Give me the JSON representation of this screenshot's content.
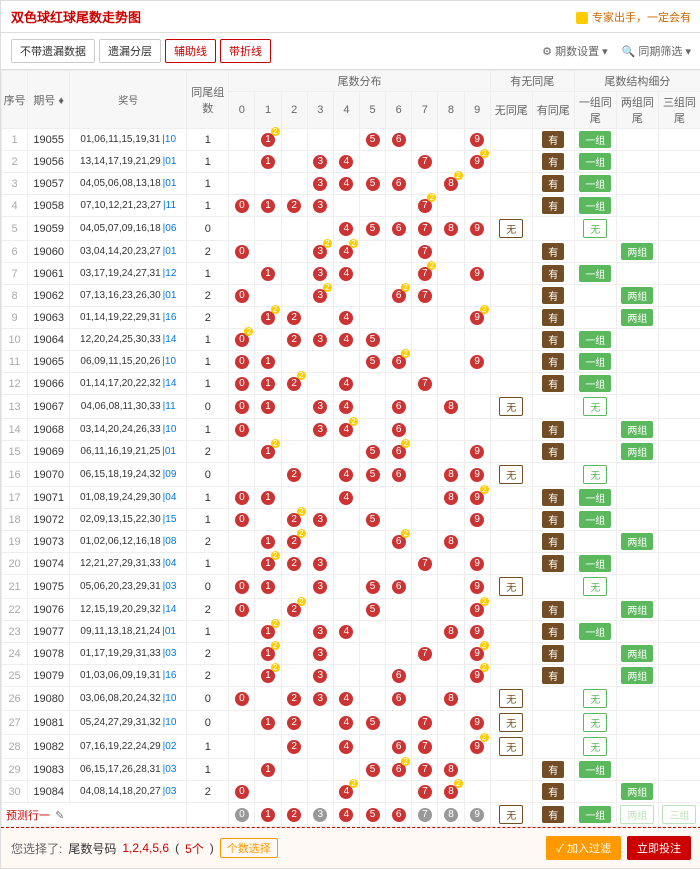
{
  "title": "双色球红球尾数走势图",
  "tip": "专家出手，一定会有",
  "ctrl": {
    "nodist": "不带遗漏数据",
    "distlayer": "遗漏分层",
    "aux": "辅助线",
    "fold": "带折线",
    "period": "期数设置",
    "filter": "同期筛选"
  },
  "headers": {
    "idx": "序号",
    "q": "期号",
    "jh": "奖号",
    "zs": "同尾组数",
    "dist": "尾数分布",
    "yw": "有无同尾",
    "wtw": "无同尾",
    "ytw": "有同尾",
    "jg": "尾数结构细分",
    "jg1": "一组同尾",
    "jg2": "两组同尾",
    "jg3": "三组同尾"
  },
  "dist_cols": [
    "0",
    "1",
    "2",
    "3",
    "4",
    "5",
    "6",
    "7",
    "8",
    "9"
  ],
  "pred": {
    "label": "预测行一",
    "sel_label": "您选择了:",
    "sel_prefix": "尾数号码",
    "sel_nums": "1,2,4,5,6",
    "sel_cnt": "5个",
    "chg": "个数选择",
    "add": "加入过滤",
    "bet": "立即投注"
  },
  "pred_tags": {
    "w": "无",
    "y": "有",
    "g1": "一组",
    "g2": "两组",
    "g3": "三组"
  },
  "chart_data": {
    "type": "table",
    "rows": [
      {
        "i": 1,
        "q": "19055",
        "jh": "01,06,11,15,19,31",
        "b": "10",
        "zs": 1,
        "hits": [
          1,
          5,
          6,
          9
        ],
        "sup": {
          "1": 2
        },
        "yw": "有",
        "jg": [
          1,
          0,
          0
        ]
      },
      {
        "i": 2,
        "q": "19056",
        "jh": "13,14,17,19,21,29",
        "b": "01",
        "zs": 1,
        "hits": [
          1,
          3,
          4,
          7,
          9
        ],
        "sup": {
          "9": 2
        },
        "yw": "有",
        "jg": [
          1,
          0,
          0
        ]
      },
      {
        "i": 3,
        "q": "19057",
        "jh": "04,05,06,08,13,18",
        "b": "01",
        "zs": 1,
        "hits": [
          3,
          4,
          5,
          6,
          8
        ],
        "sup": {
          "8": 2
        },
        "yw": "有",
        "jg": [
          1,
          0,
          0
        ]
      },
      {
        "i": 4,
        "q": "19058",
        "jh": "07,10,12,21,23,27",
        "b": "11",
        "zs": 1,
        "hits": [
          0,
          1,
          2,
          3,
          7
        ],
        "sup": {
          "7": 2
        },
        "yw": "有",
        "jg": [
          1,
          0,
          0
        ]
      },
      {
        "i": 5,
        "q": "19059",
        "jh": "04,05,07,09,16,18",
        "b": "06",
        "zs": 0,
        "hits": [
          4,
          5,
          6,
          7,
          8,
          9
        ],
        "yw": "无",
        "jg": [
          0,
          0,
          0
        ],
        "wu": true
      },
      {
        "i": 6,
        "q": "19060",
        "jh": "03,04,14,20,23,27",
        "b": "01",
        "zs": 2,
        "hits": [
          0,
          3,
          4,
          7
        ],
        "sup": {
          "3": 2,
          "4": 2
        },
        "yw": "有",
        "jg": [
          0,
          1,
          0
        ]
      },
      {
        "i": 7,
        "q": "19061",
        "jh": "03,17,19,24,27,31",
        "b": "12",
        "zs": 1,
        "hits": [
          1,
          3,
          4,
          7,
          9
        ],
        "sup": {
          "7": 2
        },
        "yw": "有",
        "jg": [
          1,
          0,
          0
        ]
      },
      {
        "i": 8,
        "q": "19062",
        "jh": "07,13,16,23,26,30",
        "b": "01",
        "zs": 2,
        "hits": [
          0,
          3,
          6,
          7
        ],
        "sup": {
          "3": 2,
          "6": 2
        },
        "yw": "有",
        "jg": [
          0,
          1,
          0
        ]
      },
      {
        "i": 9,
        "q": "19063",
        "jh": "01,14,19,22,29,31",
        "b": "16",
        "zs": 2,
        "hits": [
          1,
          2,
          4,
          9
        ],
        "sup": {
          "1": 2,
          "9": 2
        },
        "yw": "有",
        "jg": [
          0,
          1,
          0
        ]
      },
      {
        "i": 10,
        "q": "19064",
        "jh": "12,20,24,25,30,33",
        "b": "14",
        "zs": 1,
        "hits": [
          0,
          2,
          3,
          4,
          5
        ],
        "sup": {
          "0": 2
        },
        "yw": "有",
        "jg": [
          1,
          0,
          0
        ]
      },
      {
        "i": 11,
        "q": "19065",
        "jh": "06,09,11,15,20,26",
        "b": "10",
        "zs": 1,
        "hits": [
          0,
          1,
          5,
          6,
          9
        ],
        "sup": {
          "6": 2
        },
        "yw": "有",
        "jg": [
          1,
          0,
          0
        ]
      },
      {
        "i": 12,
        "q": "19066",
        "jh": "01,14,17,20,22,32",
        "b": "14",
        "zs": 1,
        "hits": [
          0,
          1,
          2,
          4,
          7
        ],
        "sup": {
          "2": 2
        },
        "yw": "有",
        "jg": [
          1,
          0,
          0
        ]
      },
      {
        "i": 13,
        "q": "19067",
        "jh": "04,06,08,11,30,33",
        "b": "11",
        "zs": 0,
        "hits": [
          0,
          1,
          3,
          4,
          6,
          8
        ],
        "yw": "无",
        "jg": [
          0,
          0,
          0
        ],
        "wu": true
      },
      {
        "i": 14,
        "q": "19068",
        "jh": "03,14,20,24,26,33",
        "b": "10",
        "zs": 1,
        "hits": [
          0,
          3,
          4,
          6
        ],
        "sup": {
          "4": 2
        },
        "yw": "有",
        "jg": [
          0,
          1,
          0
        ]
      },
      {
        "i": 15,
        "q": "19069",
        "jh": "06,11,16,19,21,25",
        "b": "01",
        "zs": 2,
        "hits": [
          1,
          5,
          6,
          9
        ],
        "sup": {
          "1": 2,
          "6": 2
        },
        "yw": "有",
        "jg": [
          0,
          1,
          0
        ]
      },
      {
        "i": 16,
        "q": "19070",
        "jh": "06,15,18,19,24,32",
        "b": "09",
        "zs": 0,
        "hits": [
          2,
          4,
          5,
          6,
          8,
          9
        ],
        "yw": "无",
        "jg": [
          0,
          0,
          0
        ],
        "wu": true
      },
      {
        "i": 17,
        "q": "19071",
        "jh": "01,08,19,24,29,30",
        "b": "04",
        "zs": 1,
        "hits": [
          0,
          1,
          4,
          8,
          9
        ],
        "sup": {
          "9": 2
        },
        "yw": "有",
        "jg": [
          1,
          0,
          0
        ]
      },
      {
        "i": 18,
        "q": "19072",
        "jh": "02,09,13,15,22,30",
        "b": "15",
        "zs": 1,
        "hits": [
          0,
          2,
          3,
          5,
          9
        ],
        "sup": {
          "2": 2
        },
        "yw": "有",
        "jg": [
          1,
          0,
          0
        ]
      },
      {
        "i": 19,
        "q": "19073",
        "jh": "01,02,06,12,16,18",
        "b": "08",
        "zs": 2,
        "hits": [
          1,
          2,
          6,
          8
        ],
        "sup": {
          "2": 2,
          "6": 2
        },
        "yw": "有",
        "jg": [
          0,
          1,
          0
        ]
      },
      {
        "i": 20,
        "q": "19074",
        "jh": "12,21,27,29,31,33",
        "b": "04",
        "zs": 1,
        "hits": [
          1,
          2,
          3,
          7,
          9
        ],
        "sup": {
          "1": 2
        },
        "yw": "有",
        "jg": [
          1,
          0,
          0
        ]
      },
      {
        "i": 21,
        "q": "19075",
        "jh": "05,06,20,23,29,31",
        "b": "03",
        "zs": 0,
        "hits": [
          0,
          1,
          3,
          5,
          6,
          9
        ],
        "yw": "无",
        "jg": [
          0,
          0,
          0
        ],
        "wu": true
      },
      {
        "i": 22,
        "q": "19076",
        "jh": "12,15,19,20,29,32",
        "b": "14",
        "zs": 2,
        "hits": [
          0,
          2,
          5,
          9
        ],
        "sup": {
          "2": 2,
          "9": 2
        },
        "yw": "有",
        "jg": [
          0,
          1,
          0
        ]
      },
      {
        "i": 23,
        "q": "19077",
        "jh": "09,11,13,18,21,24",
        "b": "01",
        "zs": 1,
        "hits": [
          1,
          3,
          4,
          8,
          9
        ],
        "sup": {
          "1": 2
        },
        "yw": "有",
        "jg": [
          1,
          0,
          0
        ]
      },
      {
        "i": 24,
        "q": "19078",
        "jh": "01,17,19,29,31,33",
        "b": "03",
        "zs": 2,
        "hits": [
          1,
          3,
          7,
          9
        ],
        "sup": {
          "1": 2,
          "9": 2
        },
        "yw": "有",
        "jg": [
          0,
          1,
          0
        ]
      },
      {
        "i": 25,
        "q": "19079",
        "jh": "01,03,06,09,19,31",
        "b": "16",
        "zs": 2,
        "hits": [
          1,
          3,
          6,
          9
        ],
        "sup": {
          "1": 2,
          "9": 2
        },
        "yw": "有",
        "jg": [
          0,
          1,
          0
        ]
      },
      {
        "i": 26,
        "q": "19080",
        "jh": "03,06,08,20,24,32",
        "b": "10",
        "zs": 0,
        "hits": [
          0,
          2,
          3,
          4,
          6,
          8
        ],
        "yw": "无",
        "jg": [
          0,
          0,
          0
        ],
        "wu": true
      },
      {
        "i": 27,
        "q": "19081",
        "jh": "05,24,27,29,31,32",
        "b": "10",
        "zs": 0,
        "hits": [
          1,
          2,
          4,
          5,
          7,
          9
        ],
        "yw": "无",
        "jg": [
          0,
          0,
          0
        ],
        "wu": true
      },
      {
        "i": 28,
        "q": "19082",
        "jh": "07,16,19,22,24,29",
        "b": "02",
        "zs": 1,
        "hits": [
          2,
          4,
          6,
          7,
          9
        ],
        "sup": {
          "9": 2
        },
        "yw": "无",
        "jg": [
          0,
          0,
          0
        ],
        "wu": true
      },
      {
        "i": 29,
        "q": "19083",
        "jh": "06,15,17,26,28,31",
        "b": "03",
        "zs": 1,
        "hits": [
          1,
          5,
          6,
          7,
          8
        ],
        "sup": {
          "6": 2
        },
        "yw": "有",
        "jg": [
          1,
          0,
          0
        ]
      },
      {
        "i": 30,
        "q": "19084",
        "jh": "04,08,14,18,20,27",
        "b": "03",
        "zs": 2,
        "hits": [
          0,
          4,
          7,
          8
        ],
        "sup": {
          "4": 2,
          "8": 2
        },
        "yw": "有",
        "jg": [
          0,
          1,
          0
        ]
      }
    ]
  }
}
